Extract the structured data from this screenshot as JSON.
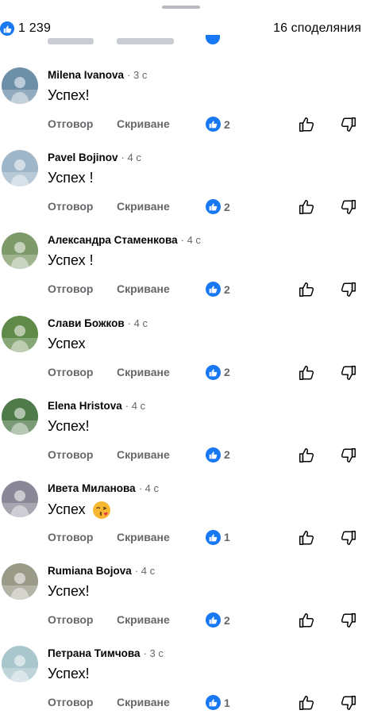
{
  "header": {
    "reaction_count": "1 239",
    "shares": "16 споделяния"
  },
  "actions": {
    "reply": "Отговор",
    "hide": "Скриване"
  },
  "comments": [
    {
      "name": "Milena Ivanova",
      "time": "· 3 с",
      "text": "Успех!",
      "likes": "2",
      "avatar_color": "#6e8fa8"
    },
    {
      "name": "Pavel Bojinov",
      "time": "· 4 с",
      "text": "Успех !",
      "likes": "2",
      "avatar_color": "#9fb6c8"
    },
    {
      "name": "Александра Стаменкова",
      "time": "· 4 с",
      "text": "Успех !",
      "likes": "2",
      "avatar_color": "#7f9a6a"
    },
    {
      "name": "Слави Божков",
      "time": "· 4 с",
      "text": "Успех",
      "likes": "2",
      "avatar_color": "#5f8a48"
    },
    {
      "name": "Elena Hristova",
      "time": "· 4 с",
      "text": "Успех!",
      "likes": "2",
      "avatar_color": "#4f7a4a"
    },
    {
      "name": "Ивета Миланова",
      "time": "· 4 с",
      "text": "Успех",
      "likes": "1",
      "avatar_color": "#8a8796",
      "emoji": "kissing-face-emoji"
    },
    {
      "name": "Rumiana Bojova",
      "time": "· 4 с",
      "text": "Успех!",
      "likes": "2",
      "avatar_color": "#9a9a88"
    },
    {
      "name": "Петрана Тимчова",
      "time": "· 3 с",
      "text": "Успех!",
      "likes": "1",
      "avatar_color": "#a8c6cc"
    }
  ],
  "colors": {
    "like_blue": "#1877f2",
    "secondary_text": "#65676b"
  }
}
